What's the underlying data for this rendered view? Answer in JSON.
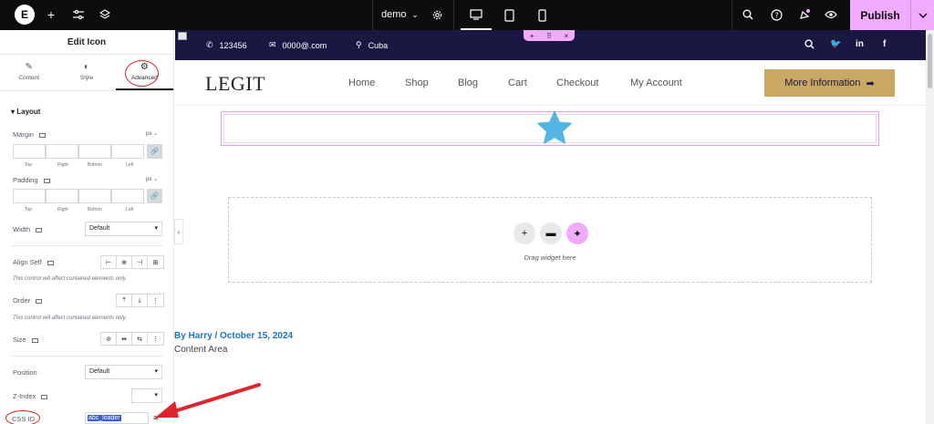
{
  "topbar": {
    "logo": "E",
    "site_name": "demo",
    "publish_label": "Publish",
    "icons": [
      "plus-icon",
      "sliders-icon",
      "layers-icon",
      "settings-icon",
      "desktop-icon",
      "tablet-icon",
      "mobile-icon",
      "search-icon",
      "help-icon",
      "notifications-icon",
      "preview-icon"
    ]
  },
  "panel": {
    "title": "Edit Icon",
    "tabs": [
      {
        "label": "Content",
        "icon": "pencil-icon"
      },
      {
        "label": "Style",
        "icon": "half-circle-icon"
      },
      {
        "label": "Advanced",
        "icon": "gear-icon"
      }
    ],
    "section": "Layout",
    "margin": {
      "label": "Margin",
      "unit": "px",
      "sides": [
        "Top",
        "Right",
        "Bottom",
        "Left"
      ]
    },
    "padding": {
      "label": "Padding",
      "unit": "px",
      "sides": [
        "Top",
        "Right",
        "Bottom",
        "Left"
      ]
    },
    "width": {
      "label": "Width",
      "value": "Default"
    },
    "align_self": {
      "label": "Align Self",
      "note": "This control will affect contained elements only."
    },
    "order": {
      "label": "Order",
      "note": "This control will affect contained elements only."
    },
    "size": {
      "label": "Size"
    },
    "position": {
      "label": "Position",
      "value": "Default"
    },
    "zindex": {
      "label": "Z-Index"
    },
    "css_id": {
      "label": "CSS ID",
      "value": "abc_loader"
    }
  },
  "site": {
    "phone": "123456",
    "email": "0000@.com",
    "location": "Cuba",
    "brand": "LEGIT",
    "nav": [
      "Home",
      "Shop",
      "Blog",
      "Cart",
      "Checkout",
      "My Account"
    ],
    "cta_label": "More Information",
    "cta_arrow": "➡",
    "drop_label": "Drag widget here",
    "byline": "By Harry / October 15, 2024",
    "content_area": "Content Area"
  },
  "colors": {
    "topbar_bg": "#0c0d0e",
    "accent_pink": "#f0abfc",
    "site_topbar_bg": "#1a1843",
    "cta_bg": "#c9a961",
    "star_color": "#54b4e6",
    "annotation_red": "#e0242d"
  }
}
